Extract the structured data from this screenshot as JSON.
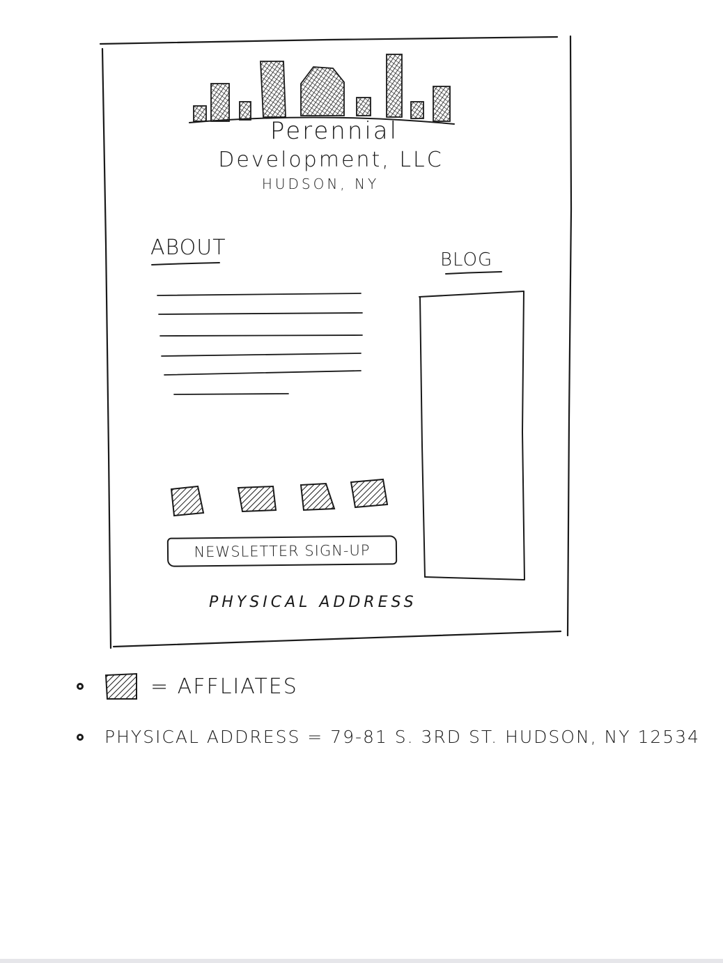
{
  "logo": {
    "company_line1": "Perennial",
    "company_line2": "Development, LLC",
    "location": "HUDSON, NY",
    "icon": "city-skyline-icon"
  },
  "about": {
    "heading": "ABOUT"
  },
  "blog": {
    "heading": "BLOG"
  },
  "affiliates": {
    "count": 4,
    "icon": "hatched-square-icon"
  },
  "newsletter": {
    "label": "NEWSLETTER SIGN-UP"
  },
  "footer": {
    "address_label": "PHYSICAL ADDRESS"
  },
  "legend": {
    "affiliates_text": "= AFFLIATES",
    "address_text": "PHYSICAL ADDRESS = 79-81 S. 3RD ST. HUDSON, NY 12534"
  },
  "colors": {
    "ink": "#1a1a1a",
    "paper": "#ffffff"
  }
}
